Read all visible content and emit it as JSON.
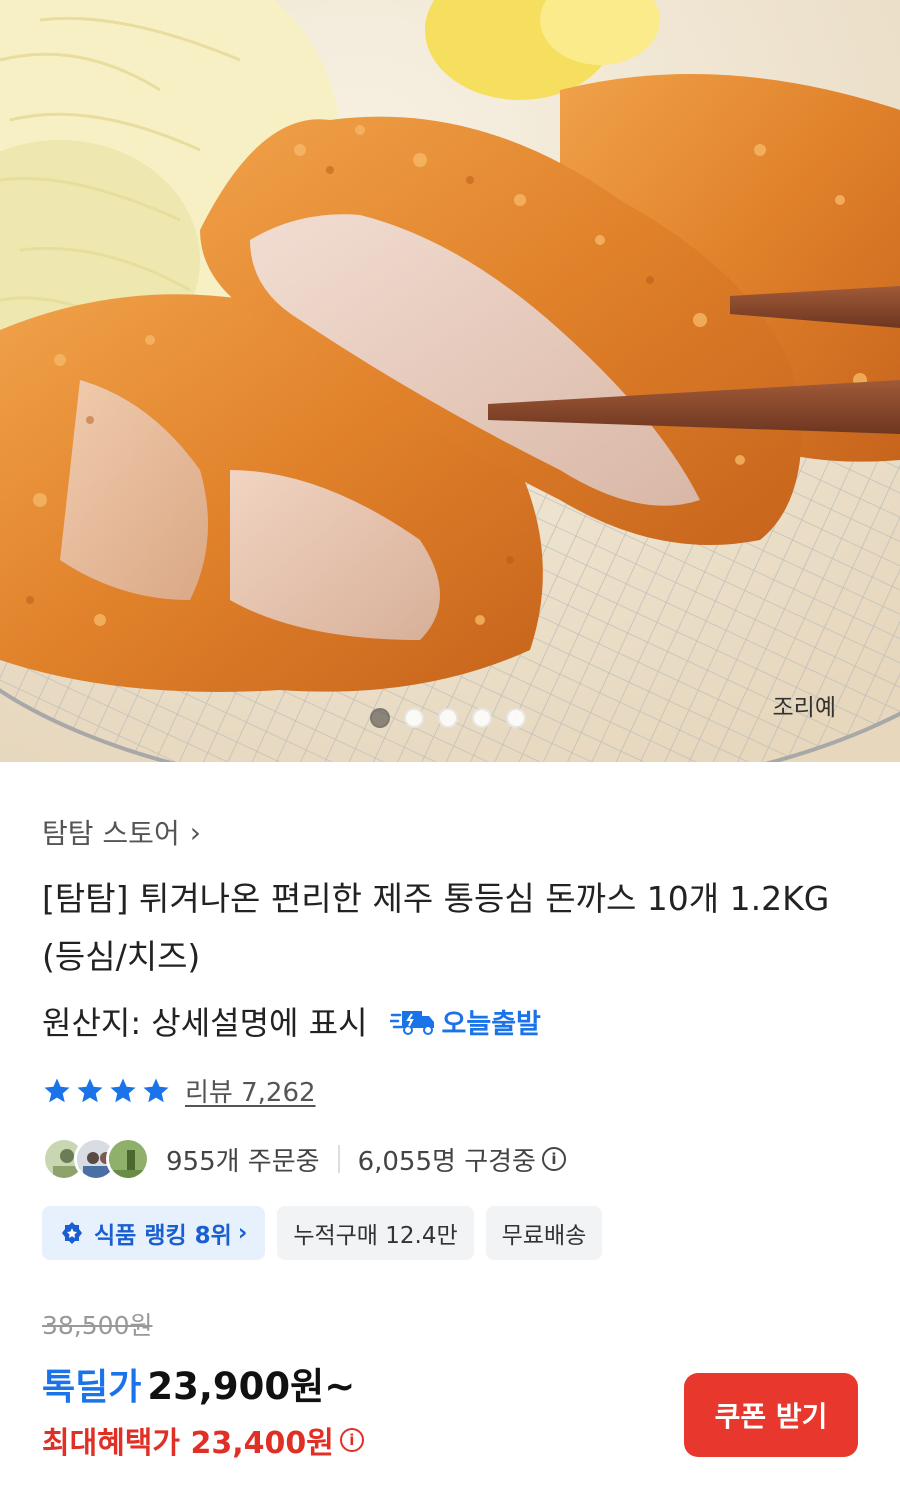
{
  "hero": {
    "caption": "조리예",
    "carousel_dots": 5,
    "active_dot": 1
  },
  "product": {
    "store_name": "탐탐 스토어",
    "title": "[탐탐] 튀겨나온 편리한 제주 통등심 돈까스 10개 1.2KG (등심/치즈)",
    "origin": "원산지: 상세설명에 표시",
    "today_badge": "오늘출발",
    "review_label": "리뷰 7,262",
    "rating_stars": 4,
    "ordering": "955개 주문중",
    "browsing": "6,055명 구경중",
    "chips": {
      "ranking": "식품 랭킹 8위",
      "cumulative": "누적구매 12.4만",
      "shipping": "무료배송"
    },
    "original_price": "38,500원",
    "deal_label": "톡딜가",
    "deal_price": "23,900원~",
    "max_benefit": "최대혜택가 23,400원",
    "coupon_button": "쿠폰 받기"
  },
  "colors": {
    "accent_blue": "#1a73e8",
    "accent_red": "#e8382d",
    "star": "#1a73e8"
  }
}
